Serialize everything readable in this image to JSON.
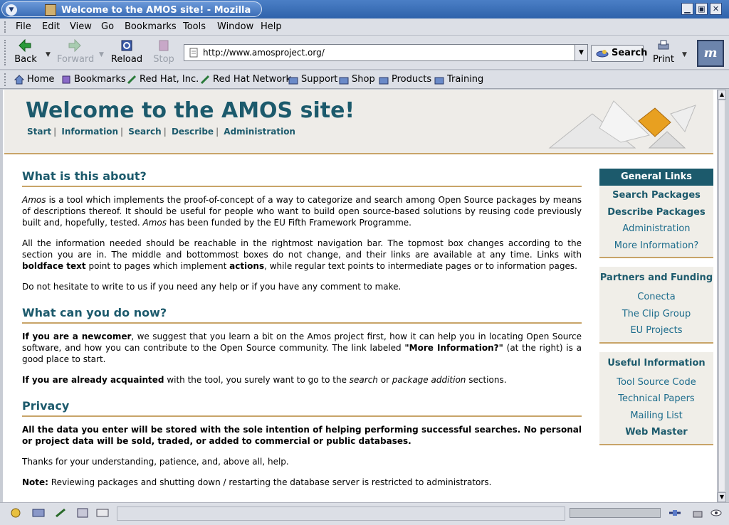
{
  "window": {
    "title": "Welcome to the AMOS site! - Mozilla"
  },
  "menu": {
    "items": [
      "File",
      "Edit",
      "View",
      "Go",
      "Bookmarks",
      "Tools",
      "Window",
      "Help"
    ]
  },
  "toolbar": {
    "back": "Back",
    "forward": "Forward",
    "reload": "Reload",
    "stop": "Stop",
    "url": "http://www.amosproject.org/",
    "search": "Search",
    "print": "Print"
  },
  "personal_toolbar": {
    "items": [
      "Home",
      "Bookmarks",
      "Red Hat, Inc.",
      "Red Hat Network",
      "Support",
      "Shop",
      "Products",
      "Training"
    ]
  },
  "page": {
    "site_title": "Welcome to the AMOS site!",
    "topnav": [
      "Start",
      "Information",
      "Search",
      "Describe",
      "Administration"
    ],
    "sections": {
      "about_title": "What is this about?",
      "about_p1_em1": "Amos",
      "about_p1_a": " is a tool which implements the proof-of-concept of a way to categorize and search among Open Source packages by means of descriptions thereof. It should be useful for people who want to build open source-based solutions by reusing code previously built and, hopefully, tested. ",
      "about_p1_em2": "Amos",
      "about_p1_b": " has been funded by the EU Fifth Framework Programme.",
      "about_p2_a": "All the information needed should be reachable in the rightmost navigation bar. The topmost box changes according to the section you are in. The middle and bottommost boxes do not change, and their links are available at any time. Links with ",
      "about_p2_b1": "boldface text",
      "about_p2_b": " point to pages which implement ",
      "about_p2_b2": "actions",
      "about_p2_c": ", while regular text points to intermediate pages or to information pages.",
      "about_p3": "Do not hesitate to write to us if you need any help or if you have any comment to make.",
      "cando_title": "What can you do now?",
      "cando_p1_b1": "If you are a newcomer",
      "cando_p1_a": ", we suggest that you learn a bit on the Amos project first, how it can help you in locating Open Source software, and how you can contribute to the Open Source community. The link labeled ",
      "cando_p1_b2": "\"More Information?\"",
      "cando_p1_b": " (at the right) is a good place to start.",
      "cando_p2_b1": "If you are already acquainted",
      "cando_p2_a": " with the tool, you surely want to go to the ",
      "cando_p2_em1": "search",
      "cando_p2_b": " or ",
      "cando_p2_em2": "package addition",
      "cando_p2_c": " sections.",
      "privacy_title": "Privacy",
      "privacy_p1": "All the data you enter will be stored with the sole intention of helping performing successful searches. No personal or project data will be sold, traded, or added to commercial or public databases.",
      "privacy_p2": "Thanks for your understanding, patience, and, above all, help.",
      "privacy_p3_b": "Note:",
      "privacy_p3": " Reviewing packages and shutting down / restarting the database server is restricted to administrators."
    }
  },
  "sidebar": {
    "general_title": "General Links",
    "general_links": [
      {
        "label": "Search Packages",
        "bold": true
      },
      {
        "label": "Describe Packages",
        "bold": true
      },
      {
        "label": "Administration",
        "bold": false
      },
      {
        "label": "More Information?",
        "bold": false
      }
    ],
    "partners_title": "Partners and Funding",
    "partners_links": [
      "Conecta",
      "The Clip Group",
      "EU Projects"
    ],
    "useful_title": "Useful Information",
    "useful_links": [
      {
        "label": "Tool Source Code",
        "bold": false
      },
      {
        "label": "Technical Papers",
        "bold": false
      },
      {
        "label": "Mailing List",
        "bold": false
      },
      {
        "label": "Web Master",
        "bold": true
      }
    ]
  },
  "colors": {
    "accent": "#1c5a6c",
    "rule": "#c8a468"
  }
}
